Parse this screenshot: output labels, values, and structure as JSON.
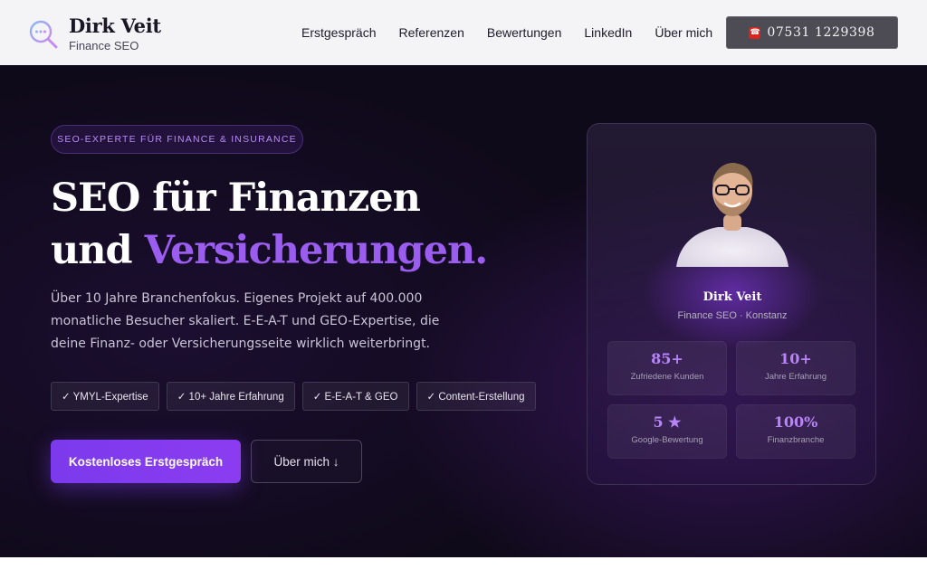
{
  "header": {
    "logo_name": "Dirk Veit",
    "logo_sub": "Finance SEO",
    "nav": [
      "Erstgespräch",
      "Referenzen",
      "Bewertungen",
      "LinkedIn",
      "Über mich"
    ],
    "phone": "07531 1229398",
    "phone_icon": "phone-icon"
  },
  "hero": {
    "badge": "SEO-EXPERTE FÜR FINANCE & INSURANCE",
    "headline_line1": "SEO für Finanzen",
    "headline_line2_plain": "und ",
    "headline_line2_accent": "Versicherungen.",
    "lead": "Über 10 Jahre Branchenfokus. Eigenes Projekt auf 400.000 monatliche Besucher skaliert. E-E-A-T und GEO-Expertise, die deine Finanz- oder Versicherungsseite wirklich weiterbringt.",
    "chips": [
      "✓ YMYL-Expertise",
      "✓ 10+ Jahre Erfahrung",
      "✓ E-E-A-T & GEO",
      "✓ Content-Erstellung"
    ],
    "cta_primary": "Kostenloses Erstgespräch",
    "cta_secondary": "Über mich ↓"
  },
  "profile": {
    "name": "Dirk Veit",
    "subtitle": "Finance SEO · Konstanz",
    "stats": [
      {
        "value": "85+",
        "label": "Zufriedene Kunden"
      },
      {
        "value": "10+",
        "label": "Jahre Erfahrung"
      },
      {
        "value": "5 ★",
        "label": "Google-Bewertung"
      },
      {
        "value": "100%",
        "label": "Finanzbranche"
      }
    ]
  },
  "colors": {
    "accent": "#9b5cf0",
    "header_bg": "#f4f3f6",
    "hero_bg": "#0f0a1a",
    "phone_button_bg": "#4d4c55"
  }
}
